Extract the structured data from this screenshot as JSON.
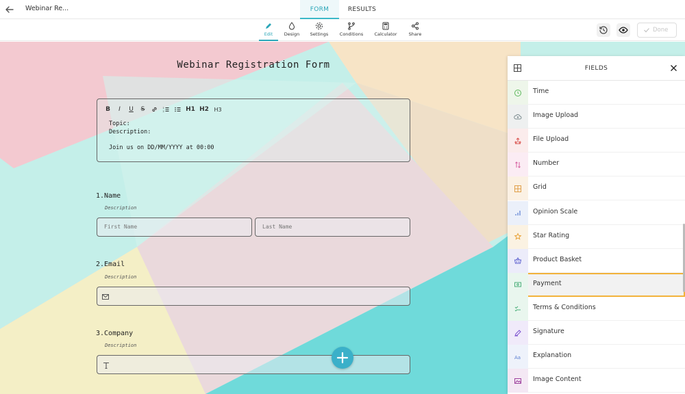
{
  "header": {
    "form_title": "Webinar Re...",
    "tabs": [
      "FORM",
      "RESULTS"
    ]
  },
  "toolbar": {
    "tools": [
      "Edit",
      "Design",
      "Settings",
      "Conditions",
      "Calculator",
      "Share"
    ],
    "done_label": "Done"
  },
  "form": {
    "title": "Webinar Registration Form",
    "rich_text": {
      "toolbar": [
        "B",
        "I",
        "U",
        "S",
        "link",
        "ol",
        "ul",
        "H1",
        "H2",
        "H3"
      ],
      "line1": "Topic:",
      "line2": "Description:",
      "line3": "Join us on DD/MM/YYYY at 00:00"
    },
    "questions": [
      {
        "label": "1.Name",
        "description": "Description",
        "placeholders": [
          "First Name",
          "Last Name"
        ]
      },
      {
        "label": "2.Email",
        "description": "Description"
      },
      {
        "label": "3.Company",
        "description": "Description"
      }
    ]
  },
  "fields_panel": {
    "title": "FIELDS",
    "items": [
      {
        "label": "Time",
        "icon": "clock-icon",
        "color": "#5cb85c",
        "bg": "#eef6ea"
      },
      {
        "label": "Image Upload",
        "icon": "cloud-upload-icon",
        "color": "#7a8a8e",
        "bg": "#eef0f0"
      },
      {
        "label": "File Upload",
        "icon": "file-upload-icon",
        "color": "#d9534f",
        "bg": "#fbecec"
      },
      {
        "label": "Number",
        "icon": "number-icon",
        "color": "#d65fa0",
        "bg": "#fbecf4"
      },
      {
        "label": "Grid",
        "icon": "grid-icon",
        "color": "#e0a04a",
        "bg": "#fbf1e4"
      },
      {
        "label": "Opinion Scale",
        "icon": "scale-icon",
        "color": "#5b7fd1",
        "bg": "#ebf0fa"
      },
      {
        "label": "Star Rating",
        "icon": "star-icon",
        "color": "#e8a33a",
        "bg": "#fbf2e2"
      },
      {
        "label": "Product Basket",
        "icon": "basket-icon",
        "color": "#5b5fcf",
        "bg": "#ececfa"
      },
      {
        "label": "Payment",
        "icon": "payment-icon",
        "color": "#4caf7a",
        "bg": "#e9f6ee"
      },
      {
        "label": "Terms & Conditions",
        "icon": "terms-icon",
        "color": "#4caf7a",
        "bg": "#e9f6ee"
      },
      {
        "label": "Signature",
        "icon": "signature-icon",
        "color": "#7a4fcf",
        "bg": "#f0eafa"
      },
      {
        "label": "Explanation",
        "icon": "explanation-icon",
        "color": "#5b7fd1",
        "bg": "#eef2fb"
      },
      {
        "label": "Image Content",
        "icon": "image-icon",
        "color": "#9c3f9c",
        "bg": "#f4e8f4"
      }
    ],
    "highlighted": "Payment"
  }
}
